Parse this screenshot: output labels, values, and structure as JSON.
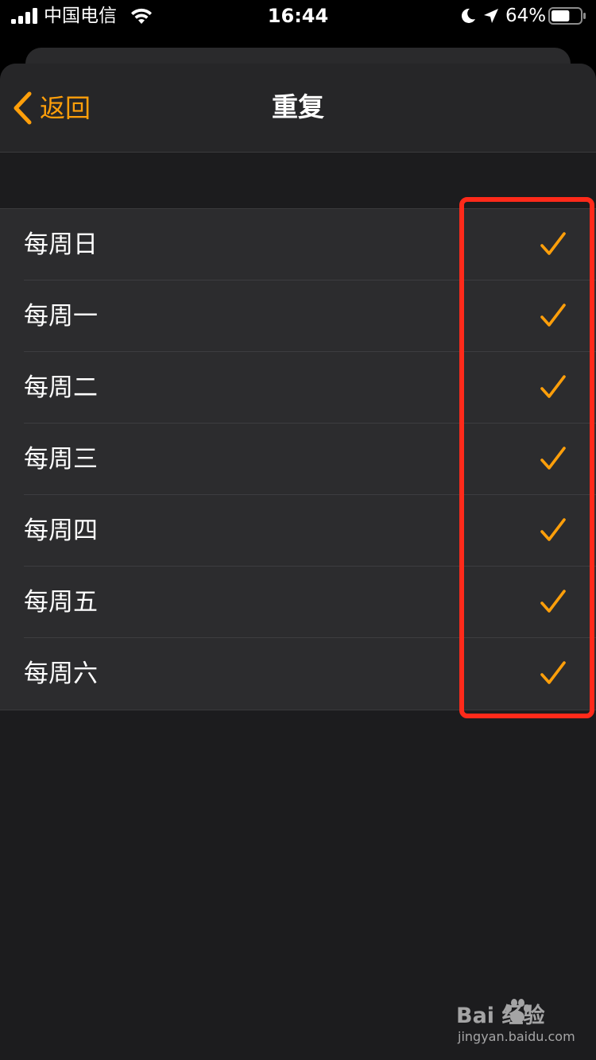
{
  "status_bar": {
    "carrier": "中国电信",
    "time": "16:44",
    "battery_percent": "64%",
    "battery_level": 0.64,
    "icons": [
      "signal-icon",
      "wifi-icon",
      "moon-icon",
      "location-icon",
      "battery-icon"
    ]
  },
  "nav": {
    "back_label": "返回",
    "title": "重复"
  },
  "days": [
    {
      "label": "每周日",
      "checked": true
    },
    {
      "label": "每周一",
      "checked": true
    },
    {
      "label": "每周二",
      "checked": true
    },
    {
      "label": "每周三",
      "checked": true
    },
    {
      "label": "每周四",
      "checked": true
    },
    {
      "label": "每周五",
      "checked": true
    },
    {
      "label": "每周六",
      "checked": true
    }
  ],
  "colors": {
    "accent": "#ff9f0a",
    "highlight": "#ff2a1a",
    "background": "#1c1c1e",
    "row_background": "#2c2c2e"
  },
  "watermark": {
    "main": "Bai  经验",
    "sub": "jingyan.baidu.com"
  }
}
